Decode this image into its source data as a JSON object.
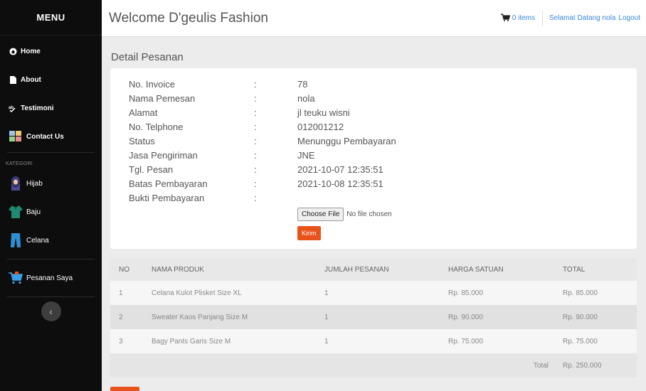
{
  "sidebar": {
    "header": "MENU",
    "items": [
      {
        "label": "Home"
      },
      {
        "label": "About"
      },
      {
        "label": "Testimoni"
      },
      {
        "label": "Contact Us"
      }
    ],
    "category_label": "KATEGORI",
    "categories": [
      {
        "label": "Hijab"
      },
      {
        "label": "Baju"
      },
      {
        "label": "Celana"
      }
    ],
    "orders_label": "Pesanan Saya"
  },
  "header": {
    "title": "Welcome D'geulis Fashion",
    "cart_label": "0 items",
    "greeting": "Selamat Datang nola",
    "logout": "Logout"
  },
  "main": {
    "page_title": "Detail Pesanan",
    "details": [
      {
        "label": "No. Invoice",
        "value": "78"
      },
      {
        "label": "Nama Pemesan",
        "value": "nola"
      },
      {
        "label": "Alamat",
        "value": "jl teuku wisni"
      },
      {
        "label": "No. Telphone",
        "value": "012001212"
      },
      {
        "label": "Status",
        "value": "Menunggu Pembayaran"
      },
      {
        "label": "Jasa Pengiriman",
        "value": "JNE"
      },
      {
        "label": "Tgl. Pesan",
        "value": "2021-10-07 12:35:51"
      },
      {
        "label": "Batas Pembayaran",
        "value": "2021-10-08 12:35:51"
      },
      {
        "label": "Bukti Pembayaran",
        "value": ""
      }
    ],
    "colon": ":",
    "file_button": "Choose File",
    "file_status": "No file chosen",
    "submit_button": "Kirim"
  },
  "table": {
    "headers": [
      "NO",
      "NAMA PRODUK",
      "JUMLAH PESANAN",
      "HARGA SATUAN",
      "TOTAL"
    ],
    "rows": [
      [
        "1",
        "Celana Kulot Plisket Size XL",
        "1",
        "Rp. 85.000",
        "Rp. 85.000"
      ],
      [
        "2",
        "Sweater Kaos Panjang Size M",
        "1",
        "Rp. 90.000",
        "Rp. 90.000"
      ],
      [
        "3",
        "Bagy Pants Garis Size M",
        "1",
        "Rp. 75.000",
        "Rp. 75.000"
      ]
    ],
    "total_label": "Total",
    "total_value": "Rp. 250.000"
  },
  "colors": {
    "accent": "#e8531b",
    "link": "#3a87e0",
    "sidebar_bg": "#0d0d0d"
  }
}
